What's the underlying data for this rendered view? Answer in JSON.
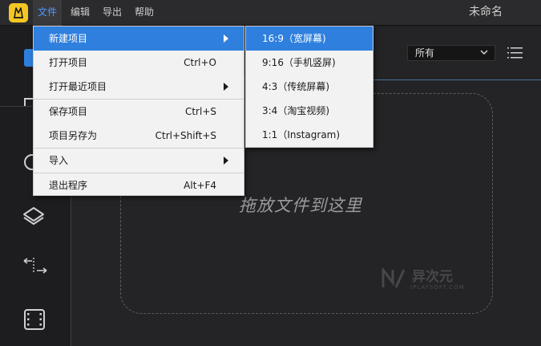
{
  "menubar": {
    "items": [
      {
        "label": "文件"
      },
      {
        "label": "编辑"
      },
      {
        "label": "导出"
      },
      {
        "label": "帮助"
      }
    ],
    "window_title": "未命名"
  },
  "main": {
    "filter": {
      "selected": "所有"
    },
    "drop_text": "拖放文件到这里",
    "watermark": {
      "main": "异次元",
      "sub": "IPLAYSOFT.COM"
    }
  },
  "file_menu": {
    "items": [
      {
        "label": "新建项目",
        "shortcut": "",
        "submenu": true
      },
      {
        "label": "打开项目",
        "shortcut": "Ctrl+O"
      },
      {
        "label": "打开最近项目",
        "shortcut": "",
        "submenu": true
      },
      {
        "label": "保存项目",
        "shortcut": "Ctrl+S"
      },
      {
        "label": "项目另存为",
        "shortcut": "Ctrl+Shift+S"
      },
      {
        "label": "导入",
        "shortcut": "",
        "submenu": true
      },
      {
        "label": "退出程序",
        "shortcut": "Alt+F4"
      }
    ]
  },
  "new_project_submenu": {
    "items": [
      {
        "label": "16:9（宽屏幕)"
      },
      {
        "label": "9:16（手机竖屏)"
      },
      {
        "label": "4:3（传统屏幕)"
      },
      {
        "label": "3:4（淘宝视频)"
      },
      {
        "label": "1:1（Instagram)"
      }
    ]
  },
  "colors": {
    "accent": "#2f7fde",
    "logo": "#f3c623",
    "active_menu_text": "#4d9bff"
  }
}
